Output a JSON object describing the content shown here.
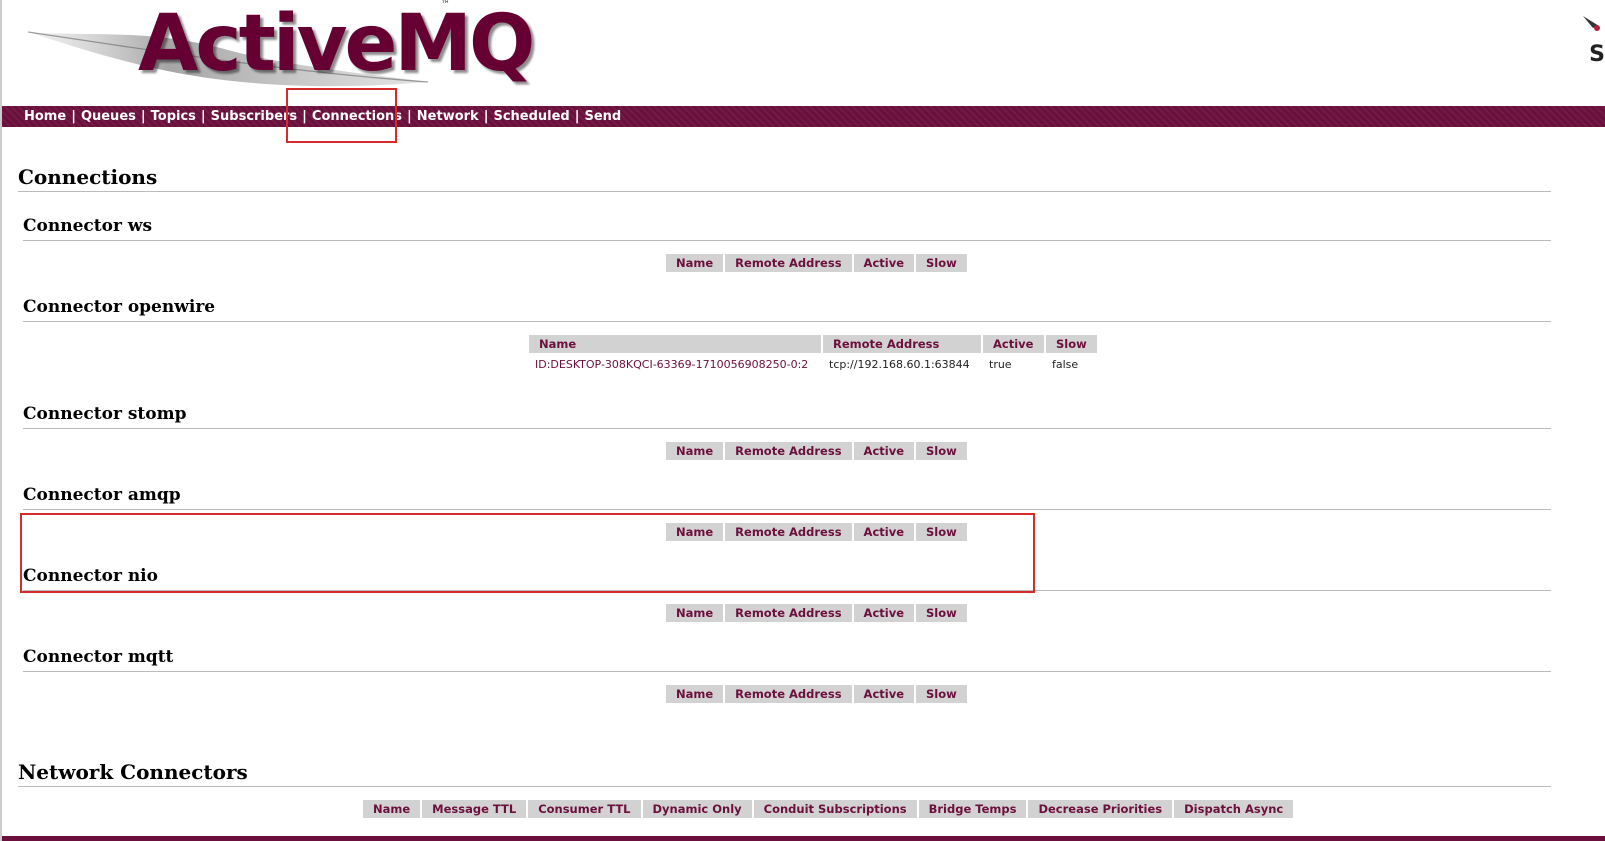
{
  "app": {
    "logo": "ActiveMQ",
    "trademark": "™",
    "corner_text": "S"
  },
  "nav": {
    "items": [
      "Home",
      "Queues",
      "Topics",
      "Subscribers",
      "Connections",
      "Network",
      "Scheduled",
      "Send"
    ],
    "separator": "|"
  },
  "connections": {
    "title": "Connections",
    "columns": [
      "Name",
      "Remote Address",
      "Active",
      "Slow"
    ],
    "connectors": [
      {
        "title": "Connector ws"
      },
      {
        "title": "Connector openwire",
        "rows": [
          {
            "name": "ID:DESKTOP-308KQCI-63369-1710056908250-0:2",
            "remote": "tcp://192.168.60.1:63844",
            "active": "true",
            "slow": "false"
          }
        ]
      },
      {
        "title": "Connector stomp"
      },
      {
        "title": "Connector amqp"
      },
      {
        "title": "Connector nio"
      },
      {
        "title": "Connector mqtt"
      }
    ]
  },
  "network": {
    "title": "Network Connectors",
    "columns": [
      "Name",
      "Message TTL",
      "Consumer TTL",
      "Dynamic Only",
      "Conduit Subscriptions",
      "Bridge Temps",
      "Decrease Priorities",
      "Dispatch Async"
    ]
  },
  "colors": {
    "brand": "#6b0f3d",
    "header_cell": "#d2d2d2",
    "highlight": "#d52b2b"
  }
}
